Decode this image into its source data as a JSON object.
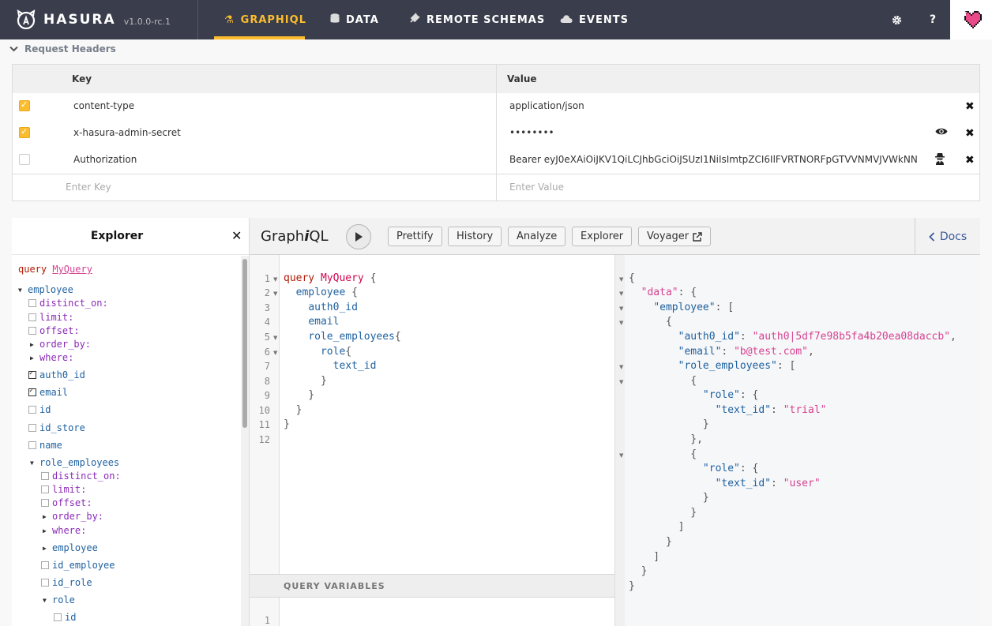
{
  "brand": {
    "name": "HASURA",
    "version": "v1.0.0-rc.1"
  },
  "nav": {
    "tabs": [
      {
        "label": "GRAPHIQL",
        "icon": "flask-icon"
      },
      {
        "label": "DATA",
        "icon": "database-icon"
      },
      {
        "label": "REMOTE SCHEMAS",
        "icon": "plug-icon"
      },
      {
        "label": "EVENTS",
        "icon": "cloud-icon"
      }
    ],
    "help_label": "?",
    "accent": "#fbbd2d"
  },
  "request_headers": {
    "title": "Request Headers",
    "col_key": "Key",
    "col_value": "Value",
    "rows": [
      {
        "key": "content-type",
        "value": "application/json",
        "checked": true
      },
      {
        "key": "x-hasura-admin-secret",
        "value": "••••••••",
        "checked": true
      },
      {
        "key": "Authorization",
        "value": "Bearer eyJ0eXAiOiJKV1QiLCJhbGciOiJSUzI1NiIsImtpZCI6IlFVRTNORFpGTVVNMVJVWkNN",
        "checked": false
      }
    ],
    "key_placeholder": "Enter Key",
    "value_placeholder": "Enter Value"
  },
  "explorer": {
    "title": "Explorer",
    "query_keyword": "query",
    "query_name": "MyQuery",
    "root": "employee",
    "args": [
      "distinct_on:",
      "limit:",
      "offset:",
      "order_by:",
      "where:"
    ],
    "fields": [
      "auth0_id",
      "email",
      "id",
      "id_store",
      "name"
    ],
    "nested": "role_employees",
    "nested_args": [
      "distinct_on:",
      "limit:",
      "offset:",
      "order_by:",
      "where:"
    ],
    "nested_fields": [
      "employee",
      "id_employee",
      "id_role",
      "role"
    ],
    "role_fields": [
      "id"
    ]
  },
  "graphiql": {
    "logo_a": "Graph",
    "logo_b": "i",
    "logo_c": "QL",
    "buttons": [
      "Prettify",
      "History",
      "Analyze",
      "Explorer",
      "Voyager"
    ],
    "docs_label": "Docs",
    "query_variables_label": "QUERY VARIABLES",
    "line_numbers": [
      "1",
      "2",
      "3",
      "4",
      "5",
      "6",
      "7",
      "8",
      "9",
      "10",
      "11",
      "12"
    ],
    "qv_line": "1",
    "query": {
      "kw": "query",
      "name": "MyQuery",
      "l2": "employee",
      "l3": "auth0_id",
      "l4": "email",
      "l5": "role_employees",
      "l6": "role",
      "l7": "text_id"
    },
    "result": {
      "data_key": "\"data\"",
      "employee_key": "\"employee\"",
      "auth0_key": "\"auth0_id\"",
      "auth0_val": "\"auth0|5df7e98b5fa4b20ea08daccb\"",
      "email_key": "\"email\"",
      "email_val": "\"b@test.com\"",
      "role_emp_key": "\"role_employees\"",
      "role_key": "\"role\"",
      "text_id_key": "\"text_id\"",
      "val_trial": "\"trial\"",
      "val_user": "\"user\""
    }
  }
}
